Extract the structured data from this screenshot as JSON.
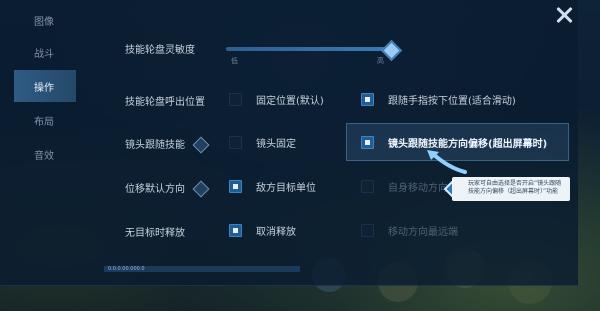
{
  "tabs": [
    {
      "label": "图像"
    },
    {
      "label": "战斗"
    },
    {
      "label": "操作"
    },
    {
      "label": "布局"
    },
    {
      "label": "音效"
    }
  ],
  "active_tab": "操作",
  "settings": {
    "sensitivity": {
      "label": "技能轮盘灵敏度",
      "min_label": "低",
      "max_label": "高",
      "value": 0.96
    },
    "wheel_position": {
      "label": "技能轮盘呼出位置",
      "options": [
        "固定位置(默认)",
        "跟随手指按下位置(适合滑动)"
      ],
      "selected": 1
    },
    "camera_follow": {
      "label": "镜头跟随技能",
      "options": [
        "镜头固定",
        "镜头跟随技能方向偏移(超出屏幕时)"
      ],
      "selected": 1
    },
    "move_direction": {
      "label": "位移默认方向",
      "options": [
        "敌方目标单位",
        "自身移动方向"
      ],
      "selected": 0
    },
    "no_target_release": {
      "label": "无目标时释放",
      "options": [
        "取消释放",
        "移动方向最远端"
      ],
      "selected": 0
    }
  },
  "tooltip": {
    "text": "玩家可自由选择是否开启“镜头跟随技能方向偏移（超出屏幕时）”功能"
  },
  "version_text": "0.0.0.00.000.0"
}
